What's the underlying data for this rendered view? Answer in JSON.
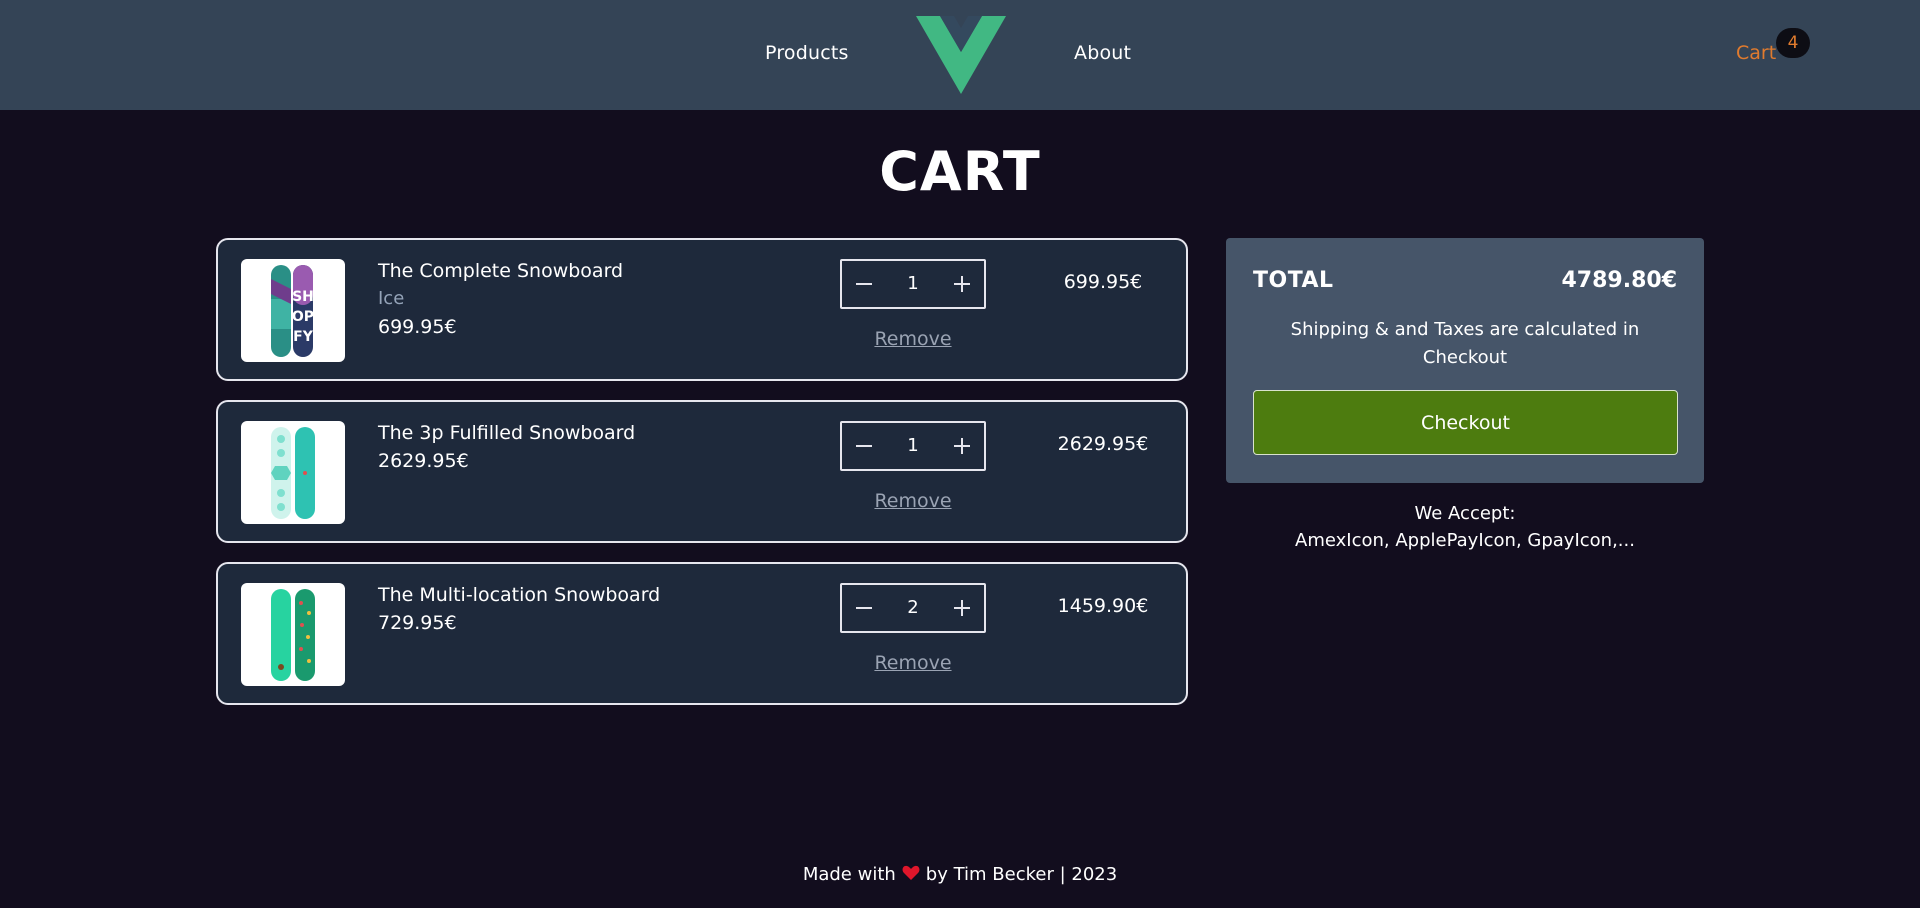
{
  "header": {
    "nav_products": "Products",
    "nav_about": "About",
    "cart_label": "Cart",
    "cart_count": "4",
    "colors": {
      "logo_outer": "#41b883",
      "logo_inner": "#34495e",
      "cart": "#e07b2e"
    }
  },
  "page": {
    "title": "CART"
  },
  "cart": {
    "items": [
      {
        "name": "The Complete Snowboard",
        "variant": "Ice",
        "unit_price": "699.95€",
        "quantity": "1",
        "line_total": "699.95€",
        "remove_label": "Remove",
        "image_icon": "snowboard-image"
      },
      {
        "name": "The 3p Fulfilled Snowboard",
        "variant": "",
        "unit_price": "2629.95€",
        "quantity": "1",
        "line_total": "2629.95€",
        "remove_label": "Remove",
        "image_icon": "snowboard-image"
      },
      {
        "name": "The Multi-location Snowboard",
        "variant": "",
        "unit_price": "729.95€",
        "quantity": "2",
        "line_total": "1459.90€",
        "remove_label": "Remove",
        "image_icon": "snowboard-image"
      }
    ]
  },
  "summary": {
    "total_label": "TOTAL",
    "total_value": "4789.80€",
    "shipping_note": "Shipping & and Taxes are calculated in Checkout",
    "checkout_label": "Checkout",
    "accept_title": "We Accept:",
    "accept_list": "AmexIcon, ApplePayIcon, GpayIcon,..."
  },
  "footer": {
    "made_with": "Made with",
    "by": "by Tim Becker | 2023",
    "icon": "heart-icon"
  }
}
